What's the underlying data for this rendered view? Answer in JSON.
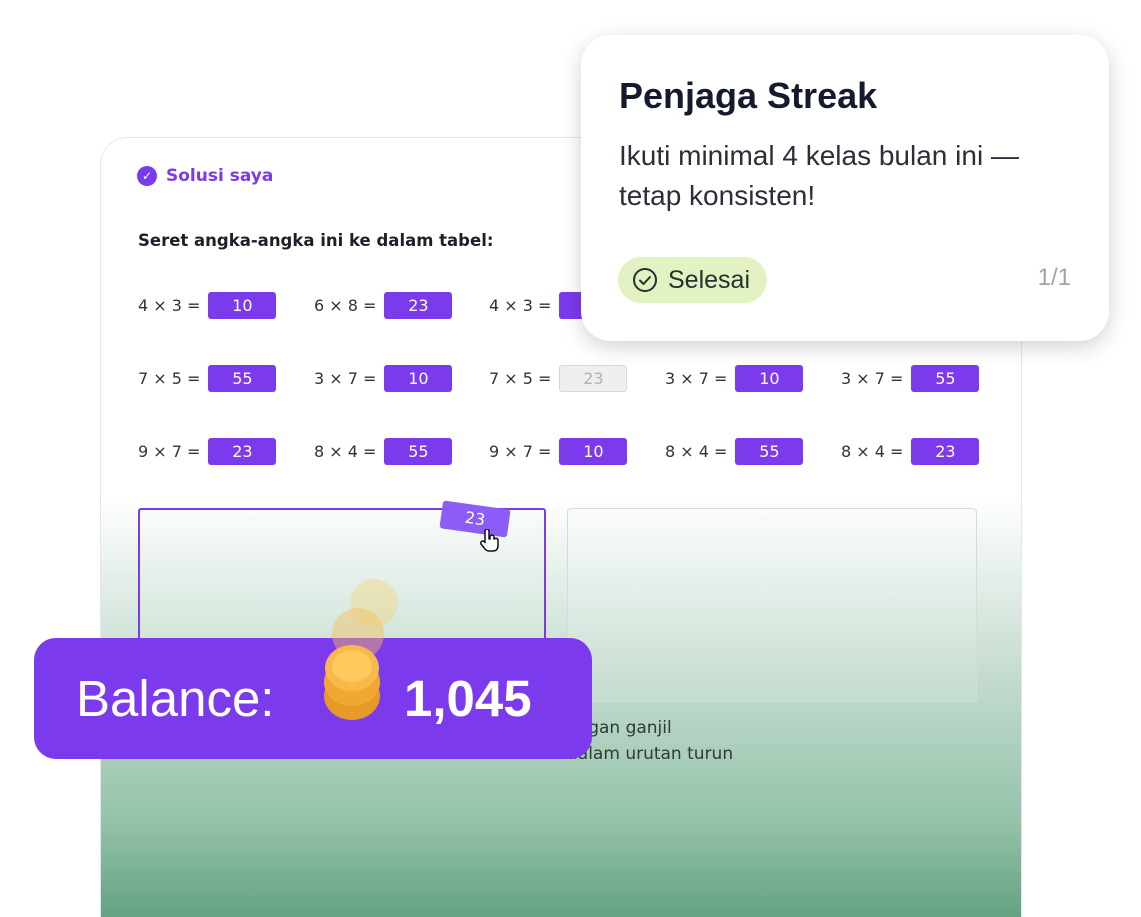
{
  "solution": {
    "title": "Solusi saya",
    "icon": "check-circle-icon"
  },
  "instruction": "Seret angka-angka ini ke dalam tabel:",
  "rows": [
    [
      {
        "expr": "4 × 3 =",
        "value": "10"
      },
      {
        "expr": "6 × 8 =",
        "value": "23"
      },
      {
        "expr": "4 × 3 =",
        "value": ""
      }
    ],
    [
      {
        "expr": "7 × 5 =",
        "value": "55"
      },
      {
        "expr": "3 × 7 =",
        "value": "10"
      },
      {
        "expr": "7 × 5 =",
        "value": "23"
      },
      {
        "expr": "3 × 7 =",
        "value": "10"
      },
      {
        "expr": "3 × 7 =",
        "value": "55"
      }
    ],
    [
      {
        "expr": "9 × 7 =",
        "value": "23"
      },
      {
        "expr": "8 × 4 =",
        "value": "55"
      },
      {
        "expr": "9 × 7 =",
        "value": "10"
      },
      {
        "expr": "8 × 4 =",
        "value": "55"
      },
      {
        "expr": "8 × 4 =",
        "value": "23"
      }
    ]
  ],
  "dragging_chip": "23",
  "rule_lines": [
    "angan ganjil",
    "dalam urutan turun"
  ],
  "popup": {
    "title": "Penjaga Streak",
    "body": "Ikuti minimal 4 kelas bulan ini — tetap konsisten!",
    "status": "Selesai",
    "status_icon": "check-circle-icon",
    "page": "1/1",
    "status_color": "#e3f2c2"
  },
  "balance": {
    "label": "Balance:",
    "value": "1,045",
    "icon": "coin-stack-icon"
  },
  "colors": {
    "accent": "#7c3aed"
  }
}
